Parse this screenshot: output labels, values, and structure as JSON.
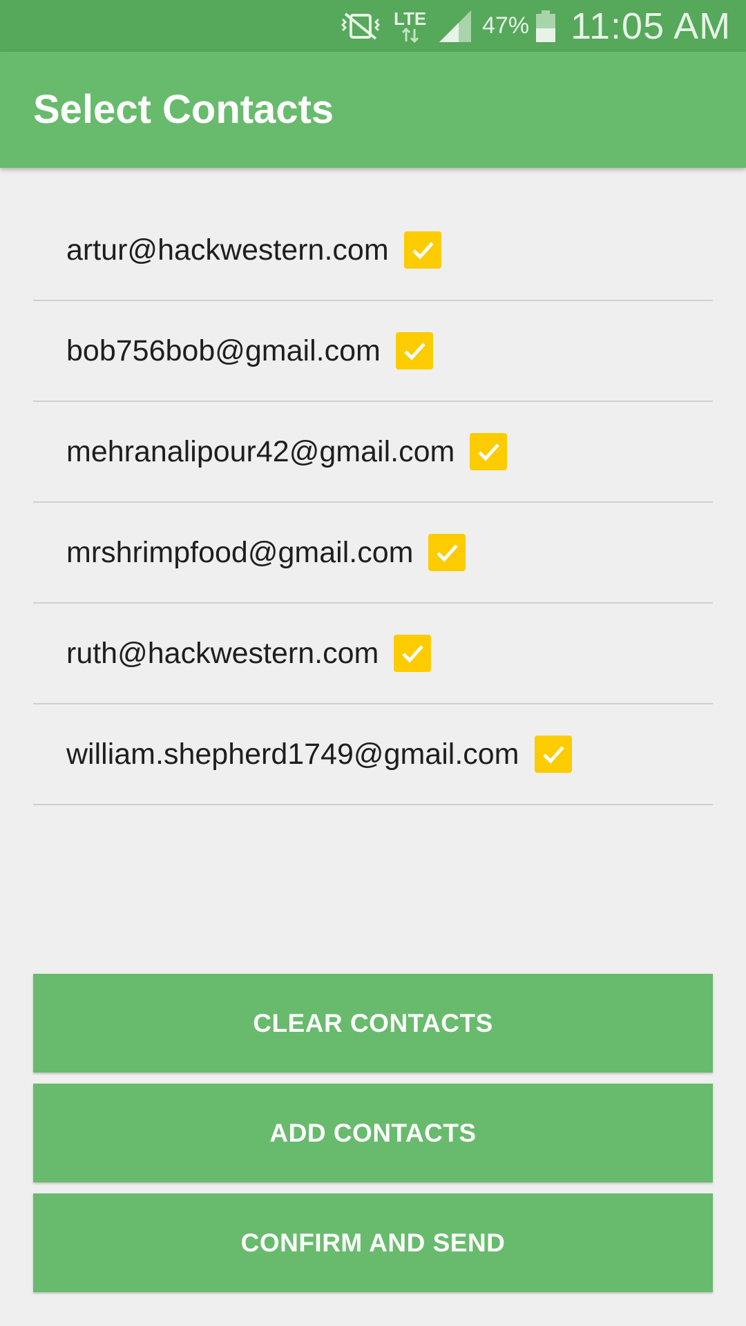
{
  "status_bar": {
    "network": "LTE",
    "battery_percent": "47%",
    "time": "11:05 AM",
    "icons": [
      "vibrate-mute-icon",
      "lte-data-icon",
      "signal-icon",
      "battery-icon"
    ]
  },
  "app_bar": {
    "title": "Select Contacts"
  },
  "contacts": [
    {
      "email": "artur@hackwestern.com",
      "checked": true
    },
    {
      "email": "bob756bob@gmail.com",
      "checked": true
    },
    {
      "email": "mehranalipour42@gmail.com",
      "checked": true
    },
    {
      "email": "mrshrimpfood@gmail.com",
      "checked": true
    },
    {
      "email": "ruth@hackwestern.com",
      "checked": true
    },
    {
      "email": "william.shepherd1749@gmail.com",
      "checked": true
    }
  ],
  "buttons": {
    "clear": "CLEAR CONTACTS",
    "add": "ADD CONTACTS",
    "confirm": "CONFIRM AND SEND"
  },
  "colors": {
    "status_bar": "#56a85a",
    "primary": "#68bb6d",
    "checkbox": "#fccb00",
    "background": "#efefef"
  }
}
